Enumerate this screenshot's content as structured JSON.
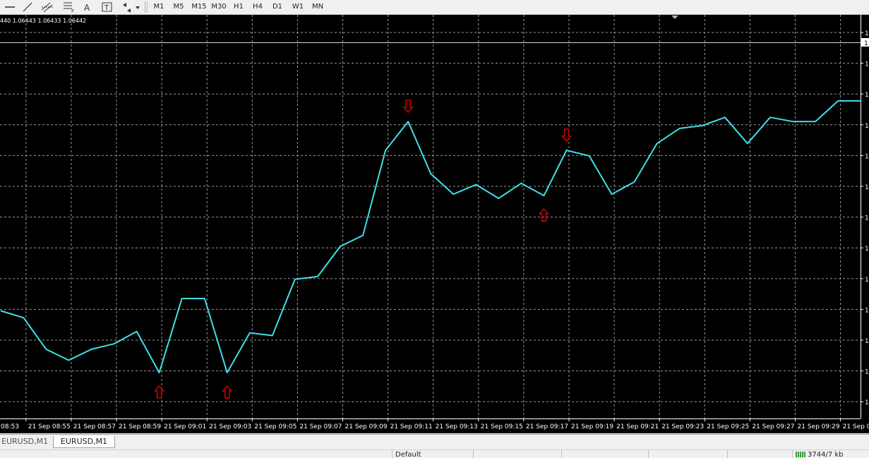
{
  "toolbar": {
    "tools": [
      {
        "name": "horizontal-line-icon",
        "label": "—"
      },
      {
        "name": "trendline-icon",
        "label": "╱"
      },
      {
        "name": "equidistant-channel-icon",
        "label": "▤"
      },
      {
        "name": "fibonacci-icon",
        "label": "F"
      },
      {
        "name": "text-tool-icon",
        "label": "A"
      },
      {
        "name": "text-label-icon",
        "label": "T"
      },
      {
        "name": "arrows-dropdown-icon",
        "label": "◈▾"
      }
    ],
    "timeframes": [
      "M1",
      "M5",
      "M15",
      "M30",
      "H1",
      "H4",
      "D1",
      "W1",
      "MN"
    ]
  },
  "chart": {
    "ohlc_text": "440 1.06443 1.06433 1.06442",
    "line_color": "#3fe0e8",
    "signal_color": "#c80000",
    "grid_color": "#9a9a9a",
    "right_scale_label": "1",
    "time_labels": [
      "08:53",
      "21 Sep 08:55",
      "21 Sep 08:57",
      "21 Sep 08:59",
      "21 Sep 09:01",
      "21 Sep 09:03",
      "21 Sep 09:05",
      "21 Sep 09:07",
      "21 Sep 09:09",
      "21 Sep 09:11",
      "21 Sep 09:13",
      "21 Sep 09:15",
      "21 Sep 09:17",
      "21 Sep 09:19",
      "21 Sep 09:21",
      "21 Sep 09:23",
      "21 Sep 09:25",
      "21 Sep 09:27",
      "21 Sep 09:29",
      "21 Sep 09:"
    ]
  },
  "chart_data": {
    "type": "line",
    "title": "",
    "xlabel": "",
    "ylabel": "",
    "series": [
      {
        "values": [
          -0.97,
          -1.02,
          -1.25,
          -1.33,
          -1.25,
          -1.21,
          -1.12,
          -1.42,
          -0.88,
          -0.88,
          -1.42,
          -1.13,
          -1.15,
          -0.74,
          -0.72,
          -0.5,
          -0.42,
          0.2,
          0.41,
          0.03,
          -0.12,
          -0.05,
          -0.15,
          -0.04,
          -0.13,
          0.2,
          0.16,
          -0.12,
          -0.03,
          0.25,
          0.36,
          0.38,
          0.44,
          0.25,
          0.44,
          0.41,
          0.41,
          0.56,
          0.56
        ]
      }
    ],
    "signals": [
      {
        "index": 7,
        "direction": "up"
      },
      {
        "index": 10,
        "direction": "up"
      },
      {
        "index": 18,
        "direction": "down"
      },
      {
        "index": 24,
        "direction": "up"
      },
      {
        "index": 25,
        "direction": "down"
      }
    ],
    "grid": true
  },
  "tabs": [
    {
      "label": "EURUSD,M1",
      "active": false
    },
    {
      "label": "EURUSD,M1",
      "active": true
    }
  ],
  "status": {
    "profile": "Default",
    "traffic": "3744/7 kb"
  }
}
